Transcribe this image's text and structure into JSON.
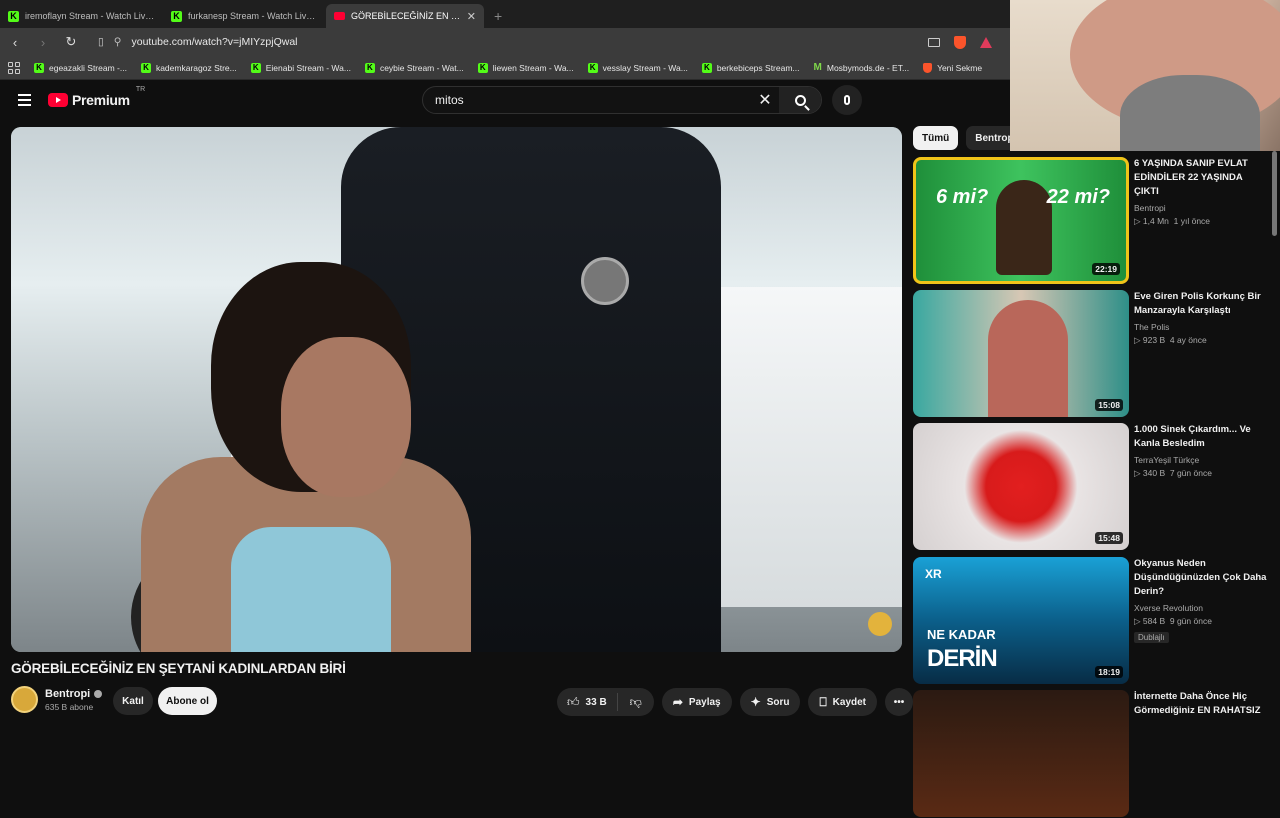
{
  "browser": {
    "tabs": [
      {
        "label": "iremoflayn Stream - Watch Live on Kick",
        "icon": "kick",
        "active": false
      },
      {
        "label": "furkanesp Stream - Watch Live on Kick",
        "icon": "kick-muted",
        "active": false
      },
      {
        "label": "GÖREBİLECEĞİNİZ EN ŞEYTANİ",
        "icon": "youtube",
        "active": true
      }
    ],
    "url": "youtube.com/watch?v=jMIYzpjQwal",
    "bookmarks": [
      "egeazakli Stream -...",
      "kademkaragoz Stre...",
      "Eienabi Stream - Wa...",
      "ceybie Stream - Wat...",
      "liewen Stream - Wa...",
      "vesslay Stream - Wa...",
      "berkebiceps Stream...",
      "Mosbymods.de - ET...",
      "Yeni Sekme"
    ],
    "brave_badge": "99+"
  },
  "youtube": {
    "logo": "Premium",
    "region": "TR",
    "search_value": "mitos"
  },
  "video": {
    "title": "GÖREBİLECEĞİNİZ EN ŞEYTANİ KADINLARDAN BİRİ",
    "channel": "Bentropi",
    "subscribers": "635 B abone",
    "join_label": "Katıl",
    "subscribe_label": "Abone ol",
    "likes": "33 B",
    "share_label": "Paylaş",
    "ask_label": "Soru",
    "save_label": "Kaydet"
  },
  "sidebar": {
    "chips": [
      "Tümü",
      "Bentropi a"
    ],
    "items": [
      {
        "title": "6 YAŞINDA SANIP EVLAT EDİNDİLER 22 YAŞINDA ÇIKTI",
        "channel": "Bentropi",
        "views": "1,4 Mn",
        "age": "1 yıl önce",
        "duration": "22:19",
        "thumb_a": "6 mi?",
        "thumb_b": "22 mi?"
      },
      {
        "title": "Eve Giren Polis Korkunç Bir Manzarayla Karşılaştı",
        "channel": "The Polis",
        "views": "923 B",
        "age": "4 ay önce",
        "duration": "15:08"
      },
      {
        "title": "1.000 Sinek Çıkardım... Ve Kanla Besledim",
        "channel": "TerraYeşil Türkçe",
        "views": "340 B",
        "age": "7 gün önce",
        "duration": "15:48"
      },
      {
        "title": "Okyanus Neden Düşündüğünüzden Çok Daha Derin?",
        "channel": "Xverse Revolution",
        "views": "584 B",
        "age": "9 gün önce",
        "duration": "18:19",
        "badge": "Dublajlı",
        "thumb_a": "NE KADAR",
        "thumb_b": "DERİN",
        "thumb_logo": "XR"
      },
      {
        "title": "İnternette Daha Önce Hiç Görmediğiniz EN RAHATSIZ"
      }
    ]
  }
}
